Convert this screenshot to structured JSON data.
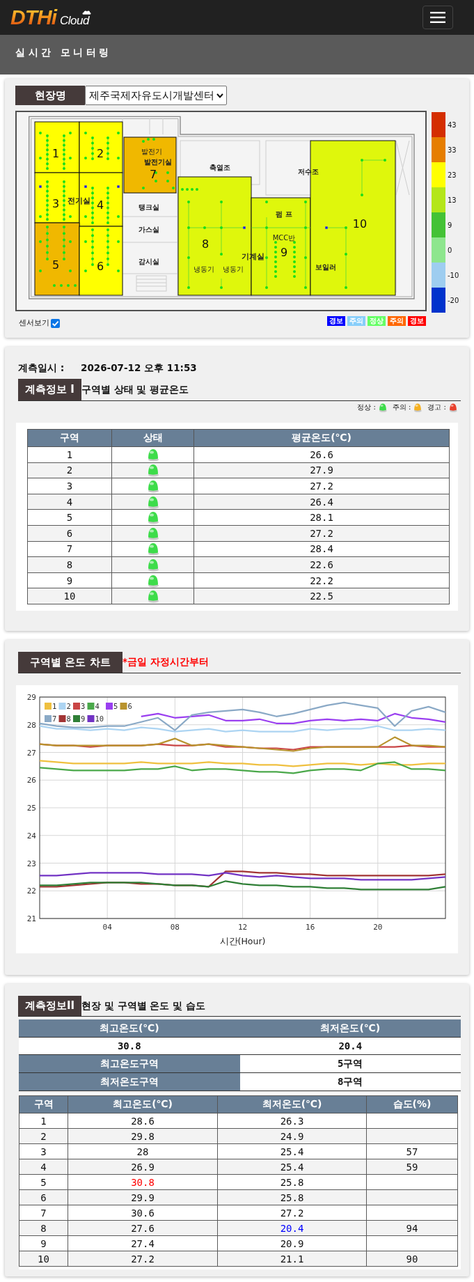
{
  "header": {
    "logo": {
      "brand": "DTHi",
      "suffix": "Cloud"
    }
  },
  "page_title": "실시간 모니터링",
  "site": {
    "label": "현장명",
    "value": "제주국제자유도시개발센터"
  },
  "floor_plan": {
    "zones": [
      {
        "number": "1",
        "color": "#ffff00"
      },
      {
        "number": "2",
        "color": "#ffff00"
      },
      {
        "number": "3",
        "color": "#ffff00"
      },
      {
        "number": "4",
        "color": "#ffff00"
      },
      {
        "number": "5",
        "color": "#f0b800"
      },
      {
        "number": "6",
        "color": "#ffff00"
      },
      {
        "number": "7",
        "color": "#f0b800"
      },
      {
        "number": "8",
        "color": "#dff70c"
      },
      {
        "number": "9",
        "color": "#dff70c"
      },
      {
        "number": "10",
        "color": "#dff70c"
      }
    ],
    "rooms": [
      {
        "name": "전기실",
        "kind": "large"
      },
      {
        "name": "발전기",
        "kind": "small"
      },
      {
        "name": "발전기실",
        "kind": "medium"
      },
      {
        "name": "축열조",
        "kind": "medium"
      },
      {
        "name": "저수조",
        "kind": "medium"
      },
      {
        "name": "탱크실",
        "kind": "medium"
      },
      {
        "name": "펌 프",
        "kind": "medium"
      },
      {
        "name": "가스실",
        "kind": "medium"
      },
      {
        "name": "MCC반",
        "kind": "small"
      },
      {
        "name": "감시실",
        "kind": "medium"
      },
      {
        "name": "냉동기",
        "kind": "small"
      },
      {
        "name": "냉동기",
        "kind": "small"
      },
      {
        "name": "기계실",
        "kind": "large"
      },
      {
        "name": "보일러",
        "kind": "medium"
      }
    ],
    "sensor_view": {
      "label": "센서보기",
      "checked": true
    },
    "color_scale": [
      {
        "label": "43",
        "color": "#d42e00"
      },
      {
        "label": "33",
        "color": "#e67e00"
      },
      {
        "label": "23",
        "color": "#ffff00"
      },
      {
        "label": "13",
        "color": "#b4e61a"
      },
      {
        "label": "9",
        "color": "#44c236"
      },
      {
        "label": "0",
        "color": "#8ee68e"
      },
      {
        "label": "-10",
        "color": "#9ecdf0"
      },
      {
        "label": "-20",
        "color": "#0033cc"
      }
    ],
    "alert_legend": [
      {
        "label": "경보",
        "color": "#0000ff"
      },
      {
        "label": "주의",
        "color": "#87cefa"
      },
      {
        "label": "정상",
        "color": "#66ff66"
      },
      {
        "label": "주의",
        "color": "#ff6600"
      },
      {
        "label": "경보",
        "color": "#ff0000"
      }
    ]
  },
  "measurement": {
    "label": "계측일시 :",
    "value": "2026-07-12 오후 11:53"
  },
  "info1": {
    "tag": "계측정보 I",
    "title": "구역별 상태 및 평균온도",
    "status_legend": [
      {
        "label": "정상 :",
        "color": "#3ddc4a"
      },
      {
        "label": "주의 :",
        "color": "#f4b020"
      },
      {
        "label": "경고 :",
        "color": "#e8402c"
      }
    ],
    "table": {
      "columns": [
        "구역",
        "상태",
        "평균온도(℃)"
      ],
      "rows": [
        {
          "zone": "1",
          "color": "#3ddc4a",
          "average": "26.6"
        },
        {
          "zone": "2",
          "color": "#3ddc4a",
          "average": "27.9"
        },
        {
          "zone": "3",
          "color": "#3ddc4a",
          "average": "27.2"
        },
        {
          "zone": "4",
          "color": "#3ddc4a",
          "average": "26.4"
        },
        {
          "zone": "5",
          "color": "#3ddc4a",
          "average": "28.1"
        },
        {
          "zone": "6",
          "color": "#3ddc4a",
          "average": "27.2"
        },
        {
          "zone": "7",
          "color": "#3ddc4a",
          "average": "28.4"
        },
        {
          "zone": "8",
          "color": "#3ddc4a",
          "average": "22.6"
        },
        {
          "zone": "9",
          "color": "#3ddc4a",
          "average": "22.2"
        },
        {
          "zone": "10",
          "color": "#3ddc4a",
          "average": "22.5"
        }
      ]
    }
  },
  "chart_section": {
    "tag": "구역별 온도 차트",
    "note": "*금일 자정시간부터",
    "chart_data": {
      "type": "line",
      "xlabel": "시간(Hour)",
      "grid": true,
      "legend": "upper left",
      "x": [
        0,
        1,
        2,
        3,
        4,
        5,
        6,
        7,
        8,
        9,
        10,
        11,
        12,
        13,
        14,
        15,
        16,
        17,
        18,
        19,
        20,
        21,
        22,
        23,
        24
      ],
      "xlim": [
        0,
        24
      ],
      "ylim": [
        21,
        29
      ],
      "xticks": [
        {
          "value": 4,
          "label": "04"
        },
        {
          "value": 8,
          "label": "08"
        },
        {
          "value": 12,
          "label": "12"
        },
        {
          "value": 16,
          "label": "16"
        },
        {
          "value": 20,
          "label": "20"
        }
      ],
      "yticks": [
        {
          "value": 21,
          "label": "21"
        },
        {
          "value": 22,
          "label": "22"
        },
        {
          "value": 23,
          "label": "23"
        },
        {
          "value": 24,
          "label": "24"
        },
        {
          "value": 25,
          "label": "25"
        },
        {
          "value": 26,
          "label": "26"
        },
        {
          "value": 27,
          "label": "27"
        },
        {
          "value": 28,
          "label": "28"
        },
        {
          "value": 29,
          "label": "29"
        }
      ],
      "series": [
        {
          "name": "1",
          "color": "#efc03f",
          "values": [
            26.7,
            26.65,
            26.6,
            26.6,
            26.6,
            26.6,
            26.65,
            26.6,
            26.6,
            26.6,
            26.65,
            26.6,
            26.6,
            26.55,
            26.55,
            26.5,
            26.55,
            26.6,
            26.6,
            26.55,
            26.6,
            26.55,
            26.55,
            26.6,
            26.6
          ]
        },
        {
          "name": "2",
          "color": "#acd4f2",
          "values": [
            27.95,
            27.85,
            27.85,
            27.8,
            27.85,
            27.8,
            27.9,
            27.85,
            27.75,
            27.8,
            27.85,
            27.75,
            27.8,
            27.75,
            27.75,
            27.75,
            27.85,
            27.8,
            27.85,
            27.85,
            27.95,
            27.8,
            27.8,
            27.85,
            27.8
          ]
        },
        {
          "name": "3",
          "color": "#c94545",
          "values": [
            27.3,
            27.25,
            27.25,
            27.2,
            27.25,
            27.25,
            27.25,
            27.3,
            27.25,
            27.25,
            27.3,
            27.2,
            27.2,
            27.15,
            27.15,
            27.1,
            27.2,
            27.2,
            27.2,
            27.2,
            27.2,
            27.2,
            27.25,
            27.2,
            27.2
          ]
        },
        {
          "name": "4",
          "color": "#4aa84a",
          "values": [
            26.45,
            26.4,
            26.35,
            26.35,
            26.35,
            26.35,
            26.4,
            26.4,
            26.5,
            26.35,
            26.4,
            26.4,
            26.35,
            26.3,
            26.3,
            26.25,
            26.35,
            26.4,
            26.4,
            26.35,
            26.6,
            26.65,
            26.4,
            26.4,
            26.35
          ]
        },
        {
          "name": "5",
          "color": "#9a3ff0",
          "values": [
            null,
            null,
            null,
            null,
            null,
            null,
            28.3,
            28.4,
            28.25,
            28.3,
            28.35,
            28.15,
            28.15,
            28.2,
            28.05,
            28.05,
            28.15,
            28.2,
            28.15,
            28.2,
            28.15,
            28.4,
            28.25,
            28.2,
            28.1
          ]
        },
        {
          "name": "6",
          "color": "#b8932e",
          "values": [
            27.3,
            27.25,
            27.25,
            27.25,
            27.25,
            27.25,
            27.25,
            27.3,
            27.5,
            27.25,
            27.3,
            27.25,
            27.2,
            27.15,
            27.1,
            27.05,
            27.15,
            27.2,
            27.2,
            27.2,
            27.2,
            27.55,
            27.25,
            27.25,
            27.2
          ]
        },
        {
          "name": "7",
          "color": "#8aa9c6",
          "values": [
            28.05,
            27.95,
            27.9,
            27.9,
            27.95,
            27.95,
            28.1,
            28.25,
            27.8,
            28.35,
            28.45,
            28.5,
            28.55,
            28.45,
            28.3,
            28.4,
            28.55,
            28.7,
            28.8,
            28.7,
            28.6,
            27.95,
            28.5,
            28.65,
            28.45
          ]
        },
        {
          "name": "8",
          "color": "#a23434",
          "values": [
            22.15,
            22.15,
            22.2,
            22.25,
            22.3,
            22.3,
            22.25,
            22.25,
            22.2,
            22.2,
            22.15,
            22.7,
            22.7,
            22.65,
            22.65,
            22.6,
            22.6,
            22.55,
            22.55,
            22.55,
            22.55,
            22.55,
            22.55,
            22.55,
            22.6
          ]
        },
        {
          "name": "9",
          "color": "#2f7f36",
          "values": [
            22.2,
            22.2,
            22.25,
            22.3,
            22.3,
            22.3,
            22.3,
            22.25,
            22.2,
            22.2,
            22.15,
            22.35,
            22.25,
            22.2,
            22.2,
            22.15,
            22.15,
            22.1,
            22.1,
            22.05,
            22.05,
            22.05,
            22.05,
            22.05,
            22.15
          ]
        },
        {
          "name": "10",
          "color": "#7233c4",
          "values": [
            22.55,
            22.55,
            22.6,
            22.65,
            22.65,
            22.65,
            22.65,
            22.6,
            22.6,
            22.6,
            22.55,
            22.65,
            22.55,
            22.5,
            22.55,
            22.5,
            22.45,
            22.45,
            22.45,
            22.4,
            22.4,
            22.4,
            22.4,
            22.45,
            22.5
          ]
        }
      ]
    }
  },
  "info2": {
    "tag": "계측정보II",
    "title": "현장 및 구역별 온도 및 습도",
    "summary": {
      "columns": [
        "최고온도(℃)",
        "최저온도(℃)"
      ],
      "values": [
        "30.8",
        "20.4"
      ],
      "rows": [
        {
          "label": "최고온도구역",
          "value": "5구역"
        },
        {
          "label": "최저온도구역",
          "value": "8구역"
        }
      ]
    },
    "table": {
      "columns": [
        "구역",
        "최고온도(℃)",
        "최저온도(℃)",
        "습도(%)"
      ],
      "rows": [
        {
          "zone": "1",
          "max": "28.6",
          "min": "26.3",
          "max_highlighted": false,
          "min_highlighted": false
        },
        {
          "zone": "2",
          "max": "29.8",
          "min": "24.9",
          "max_highlighted": false,
          "min_highlighted": false
        },
        {
          "zone": "3",
          "max": "28",
          "min": "25.4",
          "humidity": "57",
          "max_highlighted": false,
          "min_highlighted": false
        },
        {
          "zone": "4",
          "max": "26.9",
          "min": "25.4",
          "humidity": "59",
          "max_highlighted": false,
          "min_highlighted": false
        },
        {
          "zone": "5",
          "max": "30.8",
          "min": "25.8",
          "max_highlighted": true,
          "min_highlighted": false
        },
        {
          "zone": "6",
          "max": "29.9",
          "min": "25.8",
          "max_highlighted": false,
          "min_highlighted": false
        },
        {
          "zone": "7",
          "max": "30.6",
          "min": "27.2",
          "max_highlighted": false,
          "min_highlighted": false
        },
        {
          "zone": "8",
          "max": "27.6",
          "min": "20.4",
          "humidity": "94",
          "max_highlighted": false,
          "min_highlighted": true
        },
        {
          "zone": "9",
          "max": "27.4",
          "min": "20.9",
          "max_highlighted": false,
          "min_highlighted": false
        },
        {
          "zone": "10",
          "max": "27.2",
          "min": "21.1",
          "humidity": "90",
          "max_highlighted": false,
          "min_highlighted": false
        }
      ]
    }
  }
}
